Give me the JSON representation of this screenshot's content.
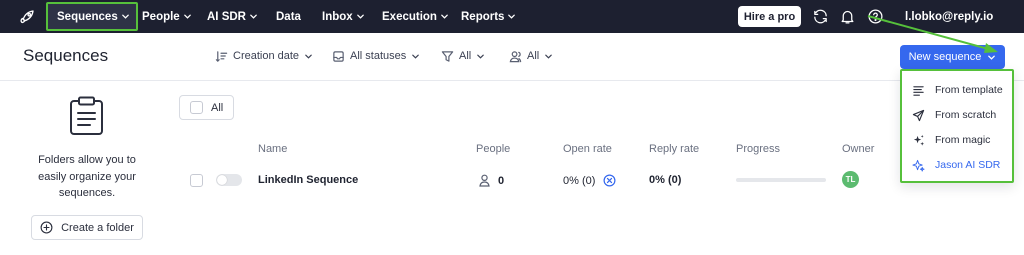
{
  "nav": {
    "items": [
      {
        "label": "Sequences",
        "dropdown": true,
        "active": true
      },
      {
        "label": "People",
        "dropdown": true
      },
      {
        "label": "AI SDR",
        "dropdown": true
      },
      {
        "label": "Data",
        "dropdown": false
      },
      {
        "label": "Inbox",
        "dropdown": true
      },
      {
        "label": "Execution",
        "dropdown": true
      },
      {
        "label": "Reports",
        "dropdown": true
      }
    ],
    "hire_label": "Hire a pro",
    "user_email": "l.lobko@reply.io",
    "icons": [
      "rocket-icon",
      "refresh-icon",
      "bell-icon",
      "help-icon",
      "chevron-down-icon"
    ]
  },
  "header": {
    "title": "Sequences",
    "filters": [
      {
        "label": "Creation date",
        "icon": "sort-icon"
      },
      {
        "label": "All statuses",
        "icon": "status-icon"
      },
      {
        "label": "All",
        "icon": "filter-icon"
      },
      {
        "label": "All",
        "icon": "user-icon"
      }
    ],
    "new_sequence_label": "New sequence"
  },
  "dropdown": {
    "items": [
      {
        "label": "From template",
        "icon": "template-icon"
      },
      {
        "label": "From scratch",
        "icon": "send-icon"
      },
      {
        "label": "From magic",
        "icon": "sparkle-icon"
      },
      {
        "label": "Jason AI SDR",
        "icon": "ai-sparkle-icon"
      }
    ]
  },
  "sidebar": {
    "empty_text": "Folders allow you to easily organize your sequences.",
    "create_folder_label": "Create a folder"
  },
  "table": {
    "select_all_label": "All",
    "columns": [
      "Name",
      "People",
      "Open rate",
      "Reply rate",
      "Progress",
      "Owner"
    ],
    "rows": [
      {
        "name": "LinkedIn Sequence",
        "people": "0",
        "open_rate": "0% (0)",
        "reply_rate": "0% (0)",
        "progress": 0,
        "owner_initials": "TL",
        "active": false
      }
    ]
  },
  "colors": {
    "nav_bg": "#1d2030",
    "accent": "#3568ee",
    "highlight": "#56c03b",
    "owner_avatar": "#5cbb70"
  }
}
